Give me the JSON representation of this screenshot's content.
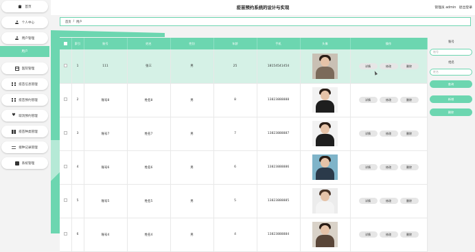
{
  "app": {
    "title": "疫苗预约系统的设计与实现",
    "user_role": "管理员 admin",
    "logout": "退出登录"
  },
  "sidebar": {
    "items": [
      {
        "label": "首页",
        "icon": "home-icon"
      },
      {
        "label": "个人中心",
        "icon": "user-icon"
      },
      {
        "label": "用户管理",
        "icon": "user-icon"
      },
      {
        "label": "用户",
        "icon": "",
        "active": true
      },
      {
        "label": "医院管理",
        "icon": "grid-icon"
      },
      {
        "label": "疫苗信息管理",
        "icon": "grid-icon"
      },
      {
        "label": "疫苗预约管理",
        "icon": "grid-icon"
      },
      {
        "label": "取消预约管理",
        "icon": "heart-icon"
      },
      {
        "label": "疫苗种类管理",
        "icon": "book-icon"
      },
      {
        "label": "接种记录管理",
        "icon": "sliders-icon"
      },
      {
        "label": "系统管理",
        "icon": "card-icon"
      }
    ]
  },
  "breadcrumb": {
    "home": "首页",
    "sep": "/",
    "current": "用户"
  },
  "table": {
    "headers": [
      "",
      "索引",
      "账号",
      "姓名",
      "性别",
      "年龄",
      "手机",
      "头像",
      "操作"
    ],
    "rows": [
      {
        "index": "1",
        "account": "111",
        "name": "张三",
        "gender": "男",
        "age": "25",
        "phone": "18154541454"
      },
      {
        "index": "2",
        "account": "账号8",
        "name": "姓名8",
        "gender": "男",
        "age": "8",
        "phone": "13823888888"
      },
      {
        "index": "3",
        "account": "账号7",
        "name": "姓名7",
        "gender": "男",
        "age": "7",
        "phone": "13823888887"
      },
      {
        "index": "4",
        "account": "账号6",
        "name": "姓名6",
        "gender": "男",
        "age": "6",
        "phone": "13823888886"
      },
      {
        "index": "5",
        "account": "账号5",
        "name": "姓名5",
        "gender": "男",
        "age": "5",
        "phone": "13823888885"
      },
      {
        "index": "6",
        "account": "账号4",
        "name": "姓名4",
        "gender": "男",
        "age": "4",
        "phone": "13823888884"
      }
    ],
    "actions": {
      "detail": "详情",
      "edit": "修改",
      "delete": "删除"
    }
  },
  "search_panel": {
    "account_label": "账号",
    "account_placeholder": "账号",
    "name_label": "姓名",
    "name_placeholder": "姓名",
    "search_button": "查询",
    "add_button": "新增",
    "delete_button": "删除"
  },
  "colors": {
    "accent": "#6cd6b0",
    "selected_row": "#d5f1e6"
  }
}
